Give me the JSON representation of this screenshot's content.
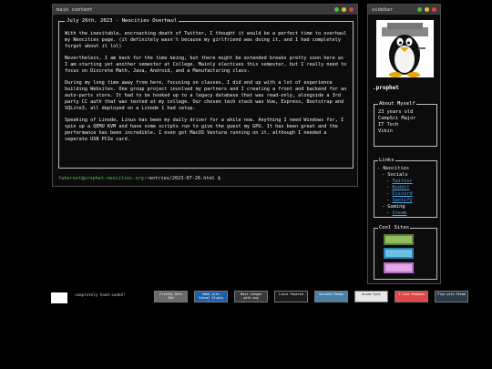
{
  "main": {
    "title": "main content",
    "post_title": "July 26th, 2023 - Neocities Overhaul",
    "paragraphs": [
      "With the inevitable, encroaching death of Twitter, I thought it would be a perfect time to overhaul my Neocities page. (it definitely wasn't because my girlfriend was doing it, and I had completely forgot about it lol)",
      "Nevertheless, I am back for the time being, but there might be extended breaks pretty soon here as I am starting yet another semester at College. Mainly electives this semester, but I really need to focus on Discrete Math, Java, Android, and a Manufacturing class.",
      "During my long time away from here, focusing on classes, I did end up with a lot of experience building Websites. One group project involved my partners and I creating a front and backend for an auto-parts store. It had to be hooked up to a legacy database that was read-only, alongside a 3rd party CC auth that was tested at my college. Our chosen tech stack was Vue, Express, Bootstrap and SQLite3, all deployed on a Linode 1 had setup.",
      "Speaking of Linode, Linux has been my daily driver for a while now. Anything I need Windows for, I spin up a QEMU KVM and have some scripts run to give the guest my GPU. It has been great and the performance has been incredible. I even got MacOS Ventura running on it, although I needed a seperate USB PCIe card."
    ],
    "prompt_user": "fakeroot@prophet.neocities.org",
    "prompt_path": ":~entries/2023-07-26.html $"
  },
  "sidebar": {
    "title": "sidebar",
    "handle": ".prophet",
    "about_legend": "About Myself",
    "about_items": [
      "23 years old",
      "CompSci Major",
      "IT Tech",
      "Vibin"
    ],
    "links_legend": "Links",
    "links_tree": [
      {
        "text": "- Neocities",
        "link": false,
        "indent": 0
      },
      {
        "text": "- Socials",
        "link": false,
        "indent": 1
      },
      {
        "text": "Twitter",
        "link": true,
        "indent": 2
      },
      {
        "text": "Reddit",
        "link": true,
        "indent": 2
      },
      {
        "text": "Discord",
        "link": true,
        "indent": 2
      },
      {
        "text": "Spotify",
        "link": true,
        "indent": 2
      },
      {
        "text": "- Gaming",
        "link": false,
        "indent": 1
      },
      {
        "text": "Steam",
        "link": true,
        "indent": 2
      }
    ],
    "cool_legend": "Cool Sites",
    "cool_sites": [
      {
        "name": "cool-site-button-1",
        "color": "#5f7f3f"
      },
      {
        "name": "cool-site-button-2",
        "color": "#2a7fbf"
      },
      {
        "name": "cool-site-button-3",
        "color": "#b06fbf"
      }
    ]
  },
  "footer": {
    "label": "completely hand-coded!",
    "badges": [
      {
        "name": "badge-1",
        "text": "Firefox Gets Ehh",
        "bg": "#6a6a6a"
      },
      {
        "name": "badge-2",
        "text": "Made with Visual Studio Code",
        "bg": "#1f5fa8"
      },
      {
        "name": "badge-3",
        "text": "Best viewed with any browser",
        "bg": "#3a3a3a"
      },
      {
        "name": "badge-4",
        "text": "Linux Powered",
        "bg": "#1a1a1a"
      },
      {
        "name": "badge-5",
        "text": "Unicode Ready",
        "bg": "#4a7fa8"
      },
      {
        "name": "badge-6",
        "text": "Anime Eyes",
        "bg": "#e8e8e8"
      },
      {
        "name": "badge-7",
        "text": "I Love Pokemon",
        "bg": "#e04848"
      },
      {
        "name": "badge-8",
        "text": "Play with Steam",
        "bg": "#2a3a4a"
      }
    ]
  },
  "colors": {
    "dot_green": "#3fbf3f",
    "dot_yellow": "#e0c030",
    "dot_red": "#e04040",
    "link": "#4aa8e8"
  }
}
